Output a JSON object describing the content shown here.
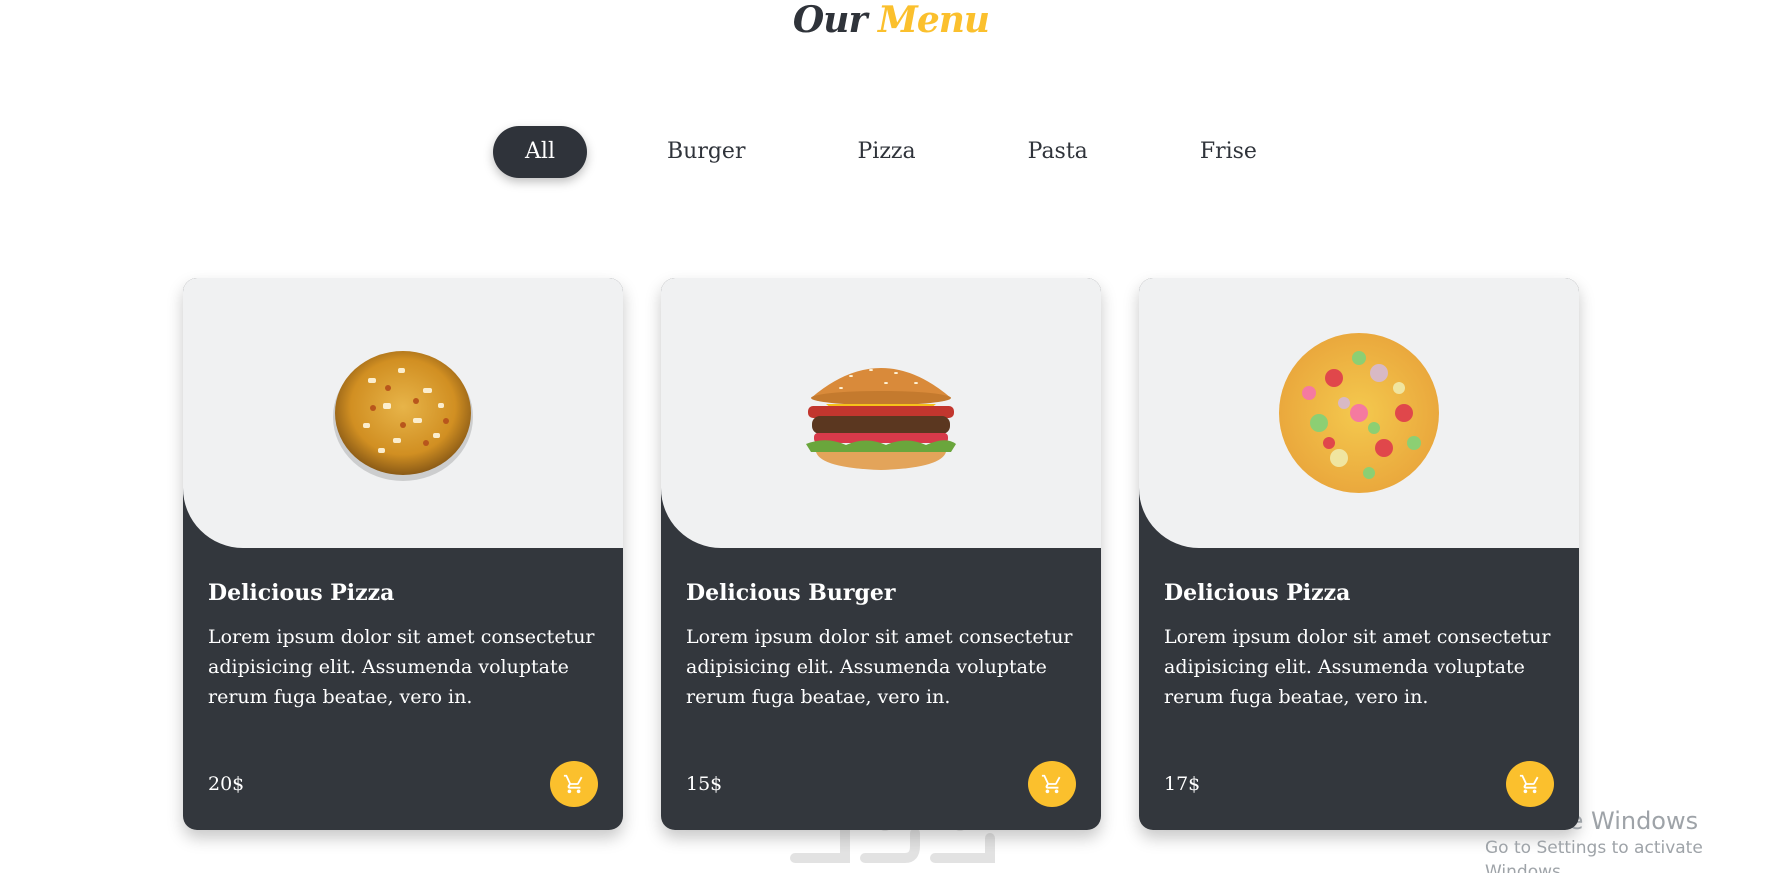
{
  "heading": {
    "first": "Our",
    "accent": "Menu",
    "accent_color": "#fbc02d",
    "dark_color": "#2f333a"
  },
  "filters": [
    {
      "label": "All",
      "active": true
    },
    {
      "label": "Burger",
      "active": false
    },
    {
      "label": "Pizza",
      "active": false
    },
    {
      "label": "Pasta",
      "active": false
    },
    {
      "label": "Frise",
      "active": false
    }
  ],
  "cards": [
    {
      "title": "Delicious Pizza",
      "description": "Lorem ipsum dolor sit amet consectetur adipisicing elit. Assumenda voluptate rerum fuga beatae, vero in.",
      "price": "20$",
      "image_icon": "pizza-image"
    },
    {
      "title": "Delicious Burger",
      "description": "Lorem ipsum dolor sit amet consectetur adipisicing elit. Assumenda voluptate rerum fuga beatae, vero in.",
      "price": "15$",
      "image_icon": "burger-image"
    },
    {
      "title": "Delicious Pizza",
      "description": "Lorem ipsum dolor sit amet consectetur adipisicing elit. Assumenda voluptate rerum fuga beatae, vero in.",
      "price": "17$",
      "image_icon": "pizza-image"
    }
  ],
  "cart_icon": "cart-icon",
  "os_overlay": {
    "title": "Activate Windows",
    "subtitle": "Go to Settings to activate Windows."
  }
}
